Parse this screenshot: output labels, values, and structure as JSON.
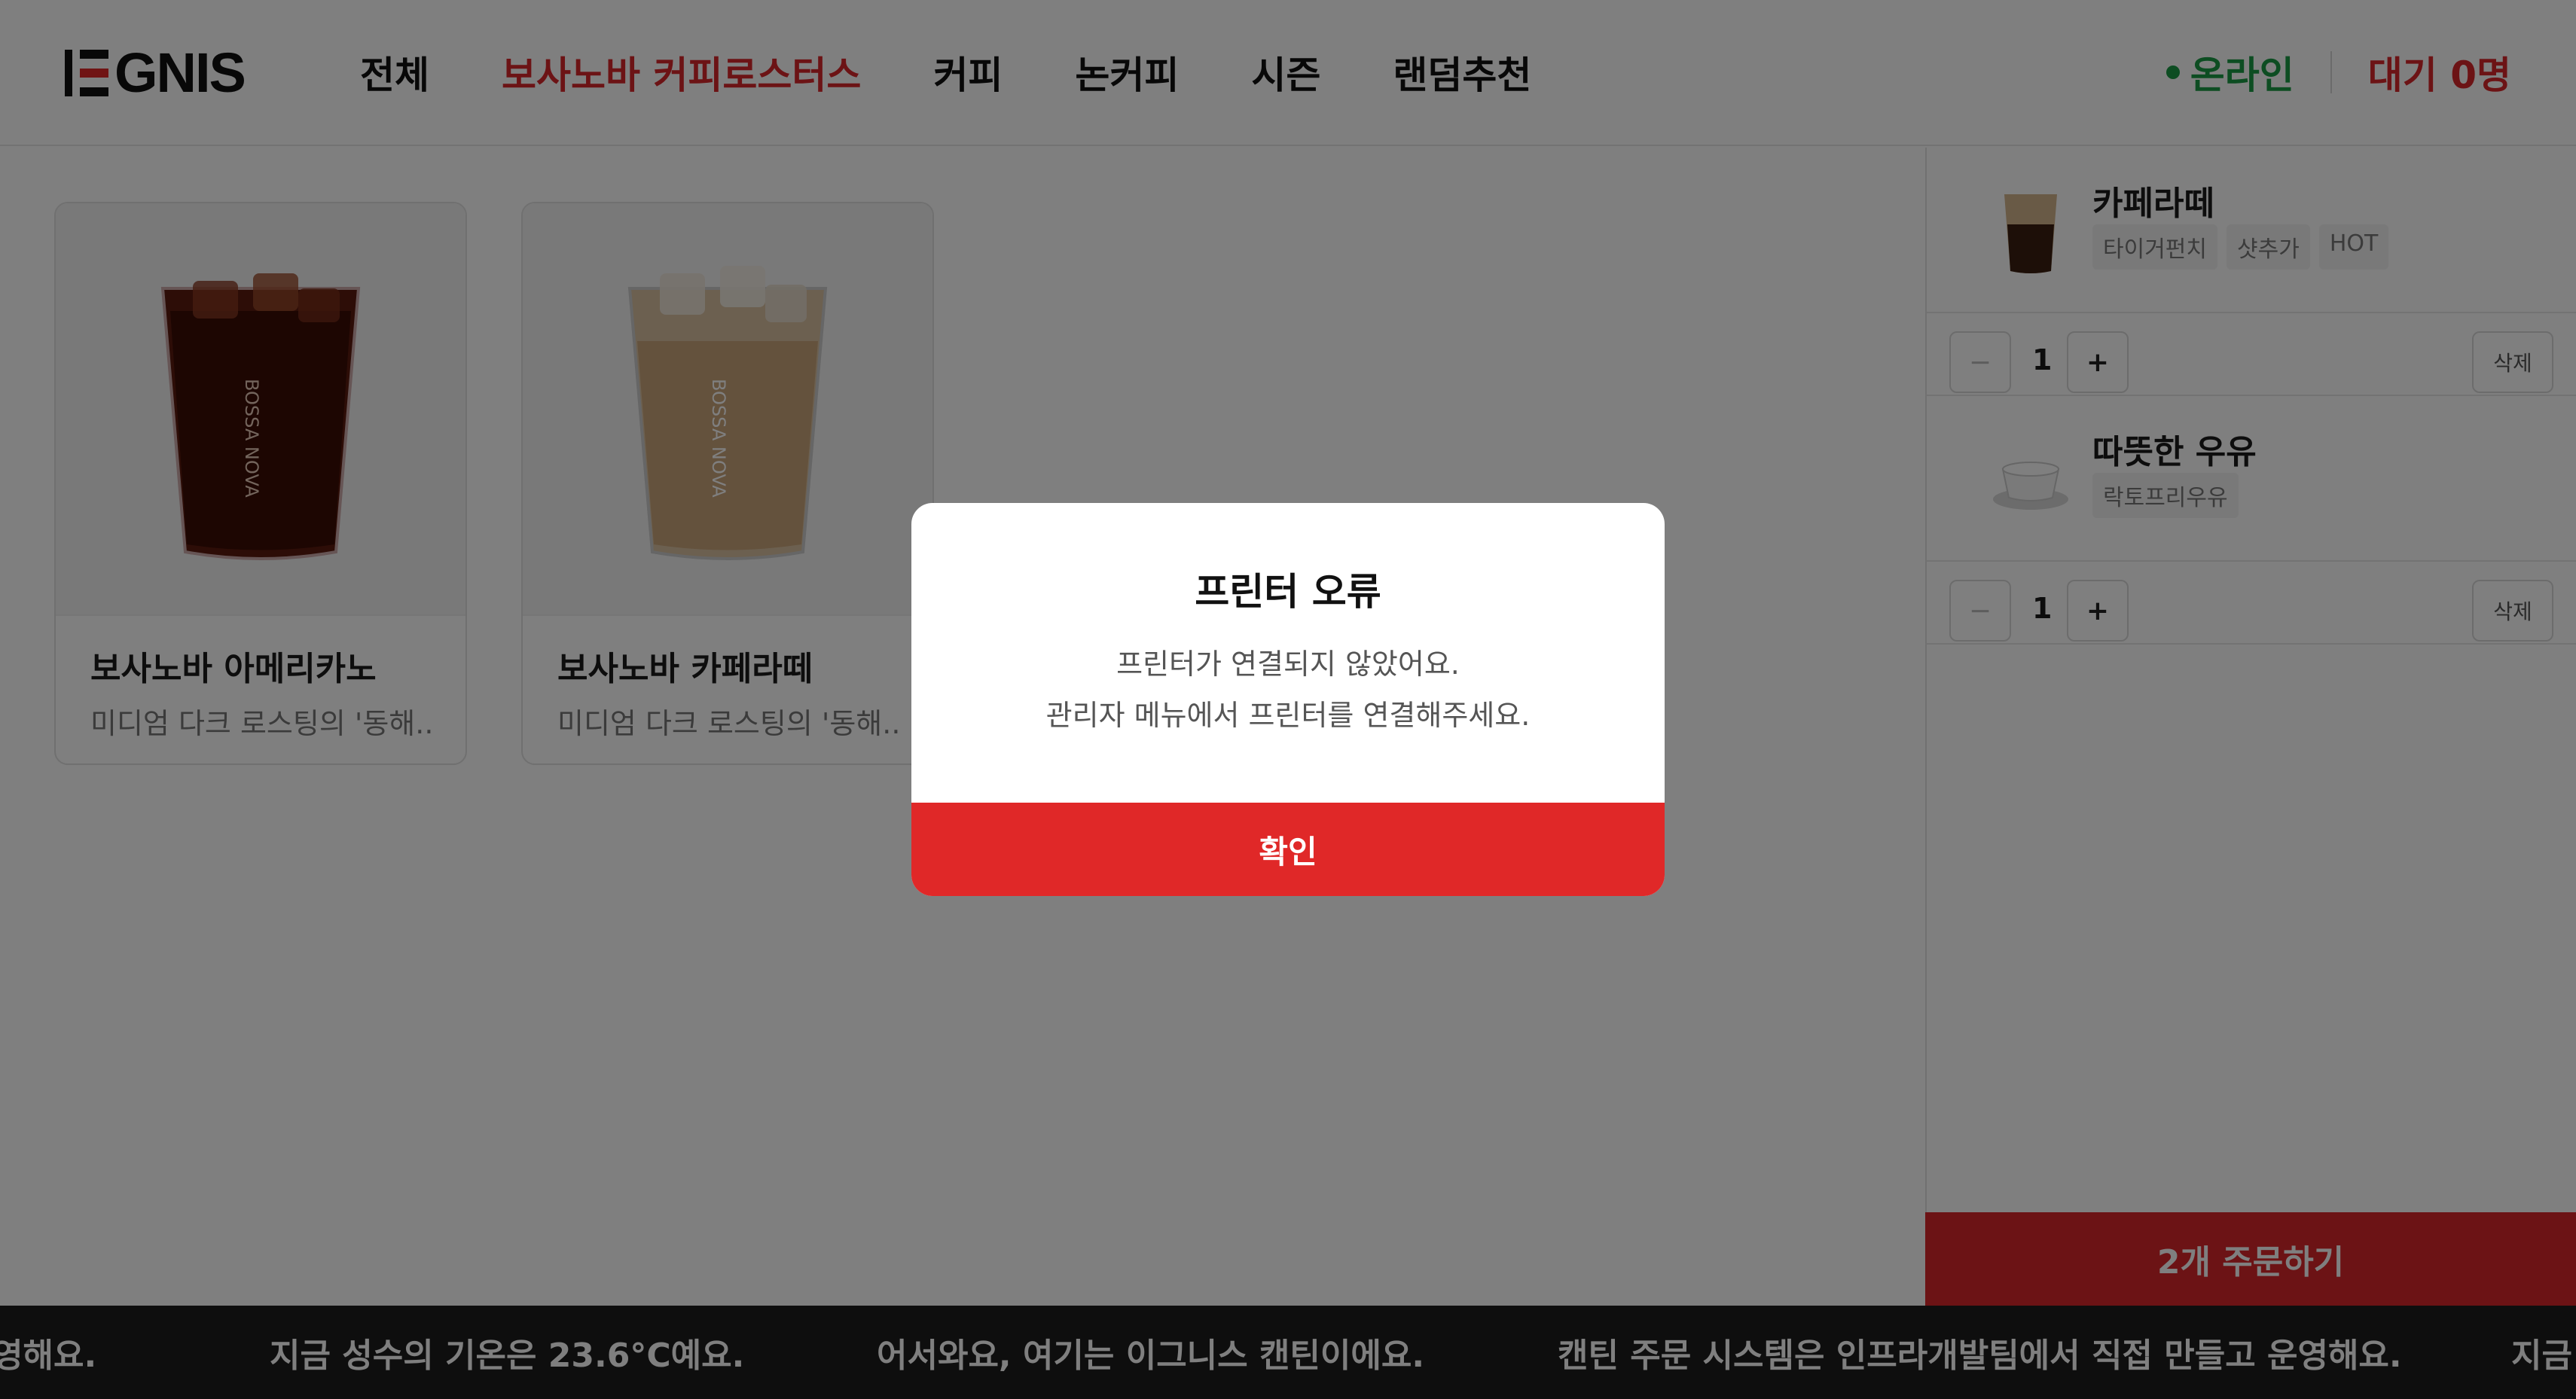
{
  "header": {
    "logo_text": "EGNIS",
    "nav": [
      "전체",
      "보사노바 커피로스터스",
      "커피",
      "논커피",
      "시즌",
      "랜덤추천"
    ],
    "active_index": 1,
    "online_label": "온라인",
    "waiting_label": "대기 0명"
  },
  "products": [
    {
      "name": "보사노바 아메리카노",
      "desc": "미디엄 다크 로스팅의 '동해...",
      "image": "iced-americano-cup"
    },
    {
      "name": "보사노바 카페라떼",
      "desc": "미디엄 다크 로스팅의 '동해...",
      "image": "iced-latte-cup"
    }
  ],
  "cart": {
    "items": [
      {
        "name": "카페라떼",
        "options": [
          "타이거펀치",
          "샷추가",
          "HOT"
        ],
        "qty": "1",
        "image": "latte-cup-icon"
      },
      {
        "name": "따뜻한 우유",
        "options": [
          "락토프리우유"
        ],
        "qty": "1",
        "image": "milk-cup-icon"
      }
    ],
    "minus_label": "−",
    "plus_label": "+",
    "delete_label": "삭제",
    "order_label": "2개 주문하기"
  },
  "ticker": [
    "영해요.",
    "지금 성수의 기온은 23.6°C예요.",
    "어서와요, 여기는 이그니스 캔틴이에요.",
    "캔틴 주문 시스템은 인프라개발팀에서 직접 만들고 운영해요.",
    "지금"
  ],
  "modal": {
    "title": "프린터 오류",
    "line1": "프린터가 연결되지 않았어요.",
    "line2": "관리자 메뉴에서 프린터를 연결해주세요.",
    "confirm": "확인"
  },
  "colors": {
    "accent": "#d9262a",
    "online": "#1a9b45",
    "ticker_bg": "#1d1d1d"
  }
}
